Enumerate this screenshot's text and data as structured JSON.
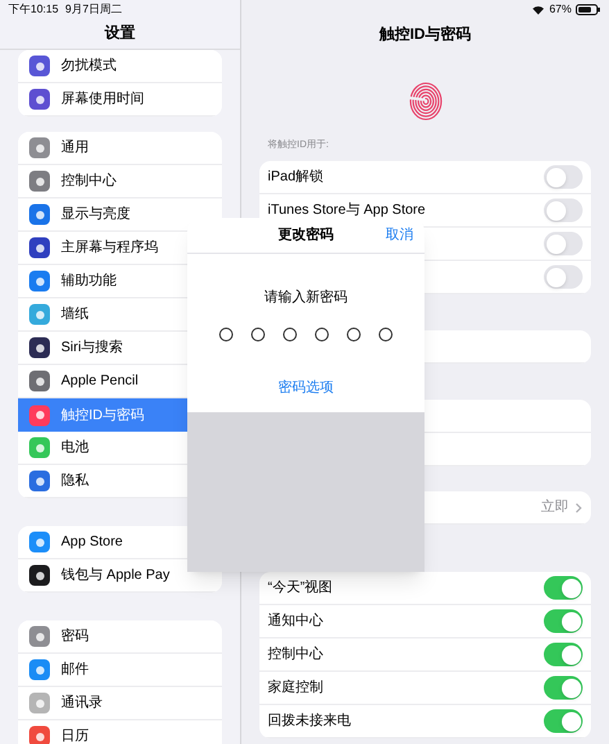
{
  "status_bar": {
    "time": "下午10:15",
    "date": "9月7日周二",
    "battery": "67%"
  },
  "sidebar": {
    "title": "设置",
    "groups": [
      {
        "items": [
          {
            "label": "勿扰模式",
            "color": "#5856d6",
            "selected": false
          },
          {
            "label": "屏幕使用时间",
            "color": "#5e4fd1",
            "selected": false
          }
        ]
      },
      {
        "items": [
          {
            "label": "通用",
            "color": "#8e8e93",
            "selected": false
          },
          {
            "label": "控制中心",
            "color": "#7d7d82",
            "selected": false
          },
          {
            "label": "显示与亮度",
            "color": "#1a73e8",
            "selected": false
          },
          {
            "label": "主屏幕与程序坞",
            "color": "#2f3fbf",
            "selected": false
          },
          {
            "label": "辅助功能",
            "color": "#1a7cf0",
            "selected": false
          },
          {
            "label": "墙纸",
            "color": "#35aadc",
            "selected": false
          },
          {
            "label": "Siri与搜索",
            "color": "#2c2c54",
            "selected": false
          },
          {
            "label": "Apple Pencil",
            "color": "#6e6e73",
            "selected": false
          },
          {
            "label": "触控ID与密码",
            "color": "#ff3b5c",
            "selected": true
          },
          {
            "label": "电池",
            "color": "#34c759",
            "selected": false
          },
          {
            "label": "隐私",
            "color": "#2a6de0",
            "selected": false
          }
        ]
      },
      {
        "items": [
          {
            "label": "App Store",
            "color": "#1c8ef9",
            "selected": false
          },
          {
            "label": "钱包与 Apple Pay",
            "color": "#1c1c1e",
            "selected": false
          }
        ]
      },
      {
        "items": [
          {
            "label": "密码",
            "color": "#8e8e93",
            "selected": false
          },
          {
            "label": "邮件",
            "color": "#1a8cf5",
            "selected": false
          },
          {
            "label": "通讯录",
            "color": "#b5b5b5",
            "selected": false
          },
          {
            "label": "日历",
            "color": "#f04a3e",
            "selected": false
          }
        ]
      }
    ]
  },
  "detail": {
    "title": "触控ID与密码",
    "section_label": "将触控ID用于:",
    "groups": [
      {
        "rows": [
          {
            "kind": "toggle",
            "label": "iPad解锁",
            "on": false
          },
          {
            "kind": "toggle",
            "label": "iTunes Store与 App Store",
            "on": false
          },
          {
            "kind": "toggle",
            "on": false
          },
          {
            "kind": "toggle",
            "on": false
          }
        ]
      },
      {
        "rows": [
          {
            "kind": "blank"
          }
        ]
      },
      {
        "rows": [
          {
            "kind": "blank"
          },
          {
            "kind": "blank"
          }
        ]
      },
      {
        "rows": [
          {
            "kind": "value",
            "value": "立即"
          }
        ]
      },
      {
        "rows": [
          {
            "kind": "toggle",
            "label": "“今天”视图",
            "on": true
          },
          {
            "kind": "toggle",
            "label": "通知中心",
            "on": true
          },
          {
            "kind": "toggle",
            "label": "控制中心",
            "on": true
          },
          {
            "kind": "toggle",
            "label": "家庭控制",
            "on": true
          },
          {
            "kind": "toggle",
            "label": "回拨未接来电",
            "on": true
          }
        ]
      }
    ]
  },
  "dialog": {
    "title": "更改密码",
    "cancel": "取消",
    "prompt": "请输入新密码",
    "digits": [
      {
        "filled": false
      },
      {
        "filled": false
      },
      {
        "filled": false
      },
      {
        "filled": false
      },
      {
        "filled": false
      },
      {
        "filled": false
      }
    ],
    "options_link": "密码选项"
  }
}
